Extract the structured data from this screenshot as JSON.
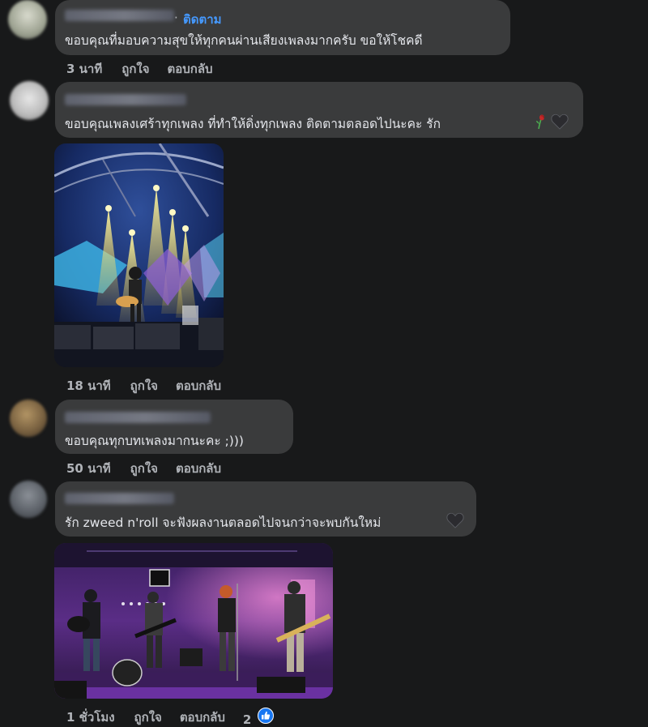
{
  "comments": [
    {
      "text": "ขอบคุณที่มอบความสุขให้ทุกคนผ่านเสียงเพลงมากครับ ขอให้โชคดี",
      "follow_label": "ติดตาม",
      "dot": "·",
      "time": "3 นาที",
      "like": "ถูกใจ",
      "reply": "ตอบกลับ"
    },
    {
      "text": "ขอบคุณเพลงเศร้าทุกเพลง ที่ทำให้ดิ่งทุกเพลง ติดตามตลอดไปนะคะ รัก",
      "emoji": [
        "wilted-rose-icon",
        "black-heart-icon"
      ],
      "time": "18 นาที",
      "like": "ถูกใจ",
      "reply": "ตอบกลับ"
    },
    {
      "text": "ขอบคุณทุกบทเพลงมากนะคะ ;)))",
      "time": "50 นาที",
      "like": "ถูกใจ",
      "reply": "ตอบกลับ"
    },
    {
      "text": "รัก zweed n'roll จะฟังผลงานตลอดไปจนกว่าจะพบกันใหม่",
      "emoji": [
        "black-heart-icon"
      ],
      "time": "1 ชั่วโมง",
      "like": "ถูกใจ",
      "reply": "ตอบกลับ",
      "reaction_count": "2",
      "reaction_icon": "like-thumb-icon"
    }
  ],
  "colors": {
    "background": "#18191a",
    "bubble": "#3a3b3c",
    "text": "#e4e6eb",
    "meta": "#b0b3b8",
    "follow": "#4599ff",
    "like_badge": "#1877f2"
  }
}
